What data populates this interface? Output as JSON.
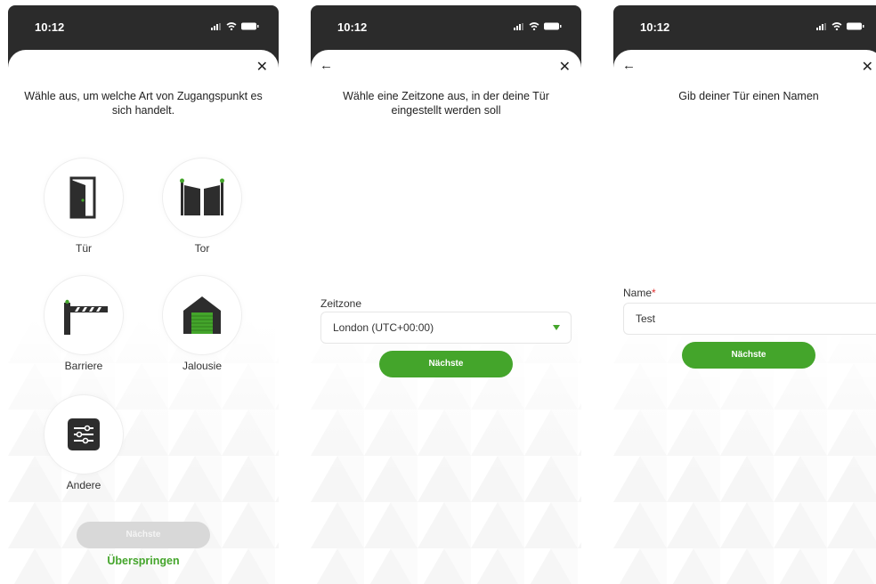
{
  "status": {
    "time": "10:12"
  },
  "screen1": {
    "title": "Wähle aus, um welche Art von Zugangspunkt es sich handelt.",
    "options": [
      {
        "label": "Tür",
        "icon": "door-icon"
      },
      {
        "label": "Tor",
        "icon": "gate-icon"
      },
      {
        "label": "Barriere",
        "icon": "barrier-icon"
      },
      {
        "label": "Jalousie",
        "icon": "shutter-icon"
      },
      {
        "label": "Andere",
        "icon": "sliders-icon"
      }
    ],
    "next_label": "Nächste",
    "skip_label": "Überspringen"
  },
  "screen2": {
    "title": "Wähle eine Zeitzone aus, in der deine Tür eingestellt werden soll",
    "field_label": "Zeitzone",
    "timezone_value": "London (UTC+00:00)",
    "next_label": "Nächste"
  },
  "screen3": {
    "title": "Gib deiner Tür einen Namen",
    "field_label": "Name",
    "required_mark": "*",
    "name_value": "Test",
    "next_label": "Nächste"
  },
  "colors": {
    "accent": "#44a52b",
    "frame": "#2b2b2b",
    "disabled": "#d8d8d8"
  }
}
